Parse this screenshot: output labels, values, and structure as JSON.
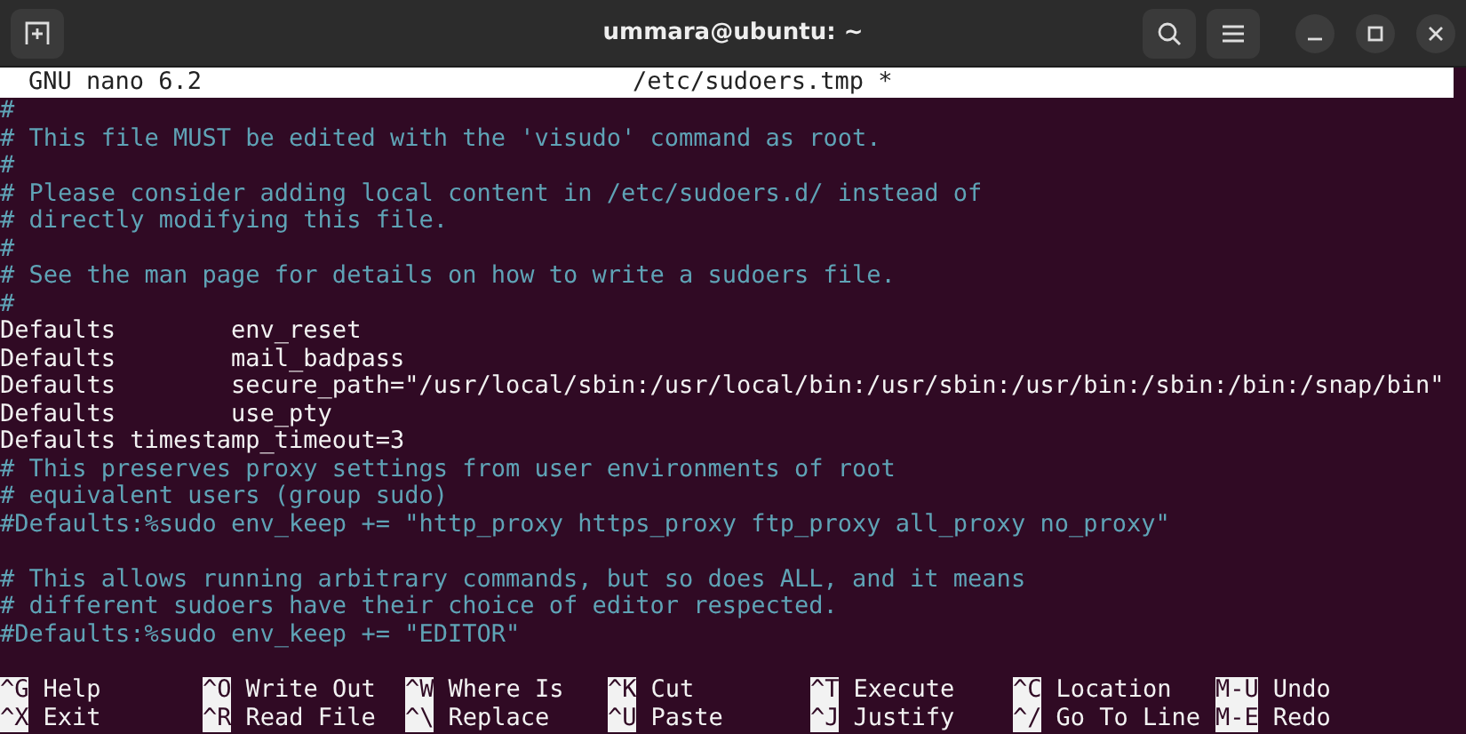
{
  "window": {
    "title": "ummara@ubuntu: ~"
  },
  "nano": {
    "version": "GNU nano 6.2",
    "filename": "/etc/sudoers.tmp *"
  },
  "lines": [
    {
      "kind": "comment",
      "text": "#"
    },
    {
      "kind": "comment",
      "text": "# This file MUST be edited with the 'visudo' command as root."
    },
    {
      "kind": "comment",
      "text": "#"
    },
    {
      "kind": "comment",
      "text": "# Please consider adding local content in /etc/sudoers.d/ instead of"
    },
    {
      "kind": "comment",
      "text": "# directly modifying this file."
    },
    {
      "kind": "comment",
      "text": "#"
    },
    {
      "kind": "comment",
      "text": "# See the man page for details on how to write a sudoers file."
    },
    {
      "kind": "comment",
      "text": "#"
    },
    {
      "kind": "code",
      "text": "Defaults        env_reset"
    },
    {
      "kind": "code",
      "text": "Defaults        mail_badpass"
    },
    {
      "kind": "code",
      "text": "Defaults        secure_path=\"/usr/local/sbin:/usr/local/bin:/usr/sbin:/usr/bin:/sbin:/bin:/snap/bin\""
    },
    {
      "kind": "code",
      "text": "Defaults        use_pty"
    },
    {
      "kind": "code",
      "text": "Defaults timestamp_timeout=3"
    },
    {
      "kind": "comment",
      "text": "# This preserves proxy settings from user environments of root"
    },
    {
      "kind": "comment",
      "text": "# equivalent users (group sudo)"
    },
    {
      "kind": "comment",
      "text": "#Defaults:%sudo env_keep += \"http_proxy https_proxy ftp_proxy all_proxy no_proxy\""
    },
    {
      "kind": "blank"
    },
    {
      "kind": "comment",
      "text": "# This allows running arbitrary commands, but so does ALL, and it means"
    },
    {
      "kind": "comment",
      "text": "# different sudoers have their choice of editor respected."
    },
    {
      "kind": "comment",
      "text": "#Defaults:%sudo env_keep += \"EDITOR\""
    }
  ],
  "shortcuts": [
    [
      {
        "key": "^G",
        "label": "Help"
      },
      {
        "key": "^O",
        "label": "Write Out"
      },
      {
        "key": "^W",
        "label": "Where Is"
      },
      {
        "key": "^K",
        "label": "Cut"
      },
      {
        "key": "^T",
        "label": "Execute"
      },
      {
        "key": "^C",
        "label": "Location"
      },
      {
        "key": "M-U",
        "label": "Undo"
      }
    ],
    [
      {
        "key": "^X",
        "label": "Exit"
      },
      {
        "key": "^R",
        "label": "Read File"
      },
      {
        "key": "^\\",
        "label": "Replace"
      },
      {
        "key": "^U",
        "label": "Paste"
      },
      {
        "key": "^J",
        "label": "Justify"
      },
      {
        "key": "^/",
        "label": "Go To Line"
      },
      {
        "key": "M-E",
        "label": "Redo"
      }
    ]
  ]
}
